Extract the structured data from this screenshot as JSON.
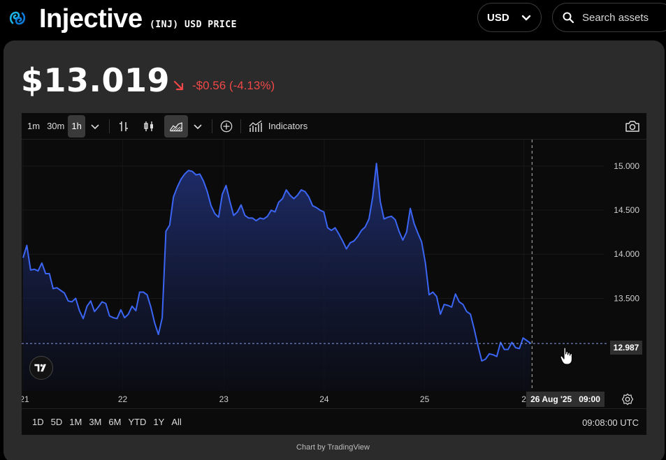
{
  "header": {
    "title": "Injective",
    "subtitle": "(INJ) USD PRICE",
    "currency": "USD",
    "search_placeholder": "Search assets"
  },
  "price": {
    "value": "$13.019",
    "change": "-$0.56 (-4.13%)",
    "change_color": "#f04848"
  },
  "toolbar": {
    "intervals": [
      "1m",
      "30m",
      "1h"
    ],
    "active_interval": "1h",
    "indicators_label": "Indicators"
  },
  "chart_overlay": {
    "last_price_tag": "12.987",
    "crosshair_time": "26 Aug '25   09:00"
  },
  "bottombar": {
    "ranges": [
      "1D",
      "5D",
      "1M",
      "3M",
      "6M",
      "YTD",
      "1Y",
      "All"
    ],
    "time": "09:08:00 UTC"
  },
  "credit": "Chart by TradingView",
  "chart_data": {
    "type": "area",
    "title": "",
    "xlabel": "",
    "ylabel": "",
    "line_color": "#3b66f5",
    "x_ticks": [
      "21",
      "22",
      "23",
      "24",
      "25",
      "2"
    ],
    "y_ticks": [
      "15.000",
      "14.500",
      "14.000",
      "13.500"
    ],
    "ylim": [
      12.45,
      15.3
    ],
    "series": [
      {
        "values": [
          13.96,
          14.1,
          13.82,
          13.83,
          13.81,
          13.9,
          13.78,
          13.78,
          13.61,
          13.62,
          13.59,
          13.56,
          13.47,
          13.46,
          13.5,
          13.36,
          13.27,
          13.41,
          13.47,
          13.35,
          13.4,
          13.46,
          13.44,
          13.3,
          13.28,
          13.27,
          13.37,
          13.28,
          13.32,
          13.41,
          13.36,
          13.57,
          13.57,
          13.54,
          13.4,
          13.22,
          13.09,
          13.28,
          14.26,
          14.33,
          14.65,
          14.76,
          14.85,
          14.91,
          14.95,
          14.94,
          14.9,
          14.91,
          14.83,
          14.71,
          14.55,
          14.46,
          14.42,
          14.68,
          14.78,
          14.6,
          14.44,
          14.48,
          14.56,
          14.44,
          14.41,
          14.41,
          14.38,
          14.41,
          14.4,
          14.43,
          14.5,
          14.48,
          14.59,
          14.63,
          14.73,
          14.67,
          14.63,
          14.67,
          14.73,
          14.71,
          14.65,
          14.55,
          14.53,
          14.5,
          14.48,
          14.3,
          14.27,
          14.3,
          14.23,
          14.15,
          14.06,
          14.13,
          14.15,
          14.2,
          14.27,
          14.31,
          14.4,
          14.65,
          15.03,
          14.6,
          14.4,
          14.42,
          14.43,
          14.39,
          14.26,
          14.16,
          14.25,
          14.52,
          14.35,
          14.24,
          14.14,
          13.9,
          13.54,
          13.57,
          13.52,
          13.32,
          13.43,
          13.42,
          13.4,
          13.55,
          13.46,
          13.43,
          13.35,
          13.32,
          13.15,
          12.96,
          12.79,
          12.81,
          12.87,
          12.86,
          12.84,
          13.0,
          12.92,
          12.92,
          13.0,
          12.94,
          12.93,
          13.05,
          13.02,
          12.99
        ]
      }
    ],
    "last_value": 12.987,
    "crosshair_x_index": 135,
    "grid": true,
    "legend": "none"
  }
}
